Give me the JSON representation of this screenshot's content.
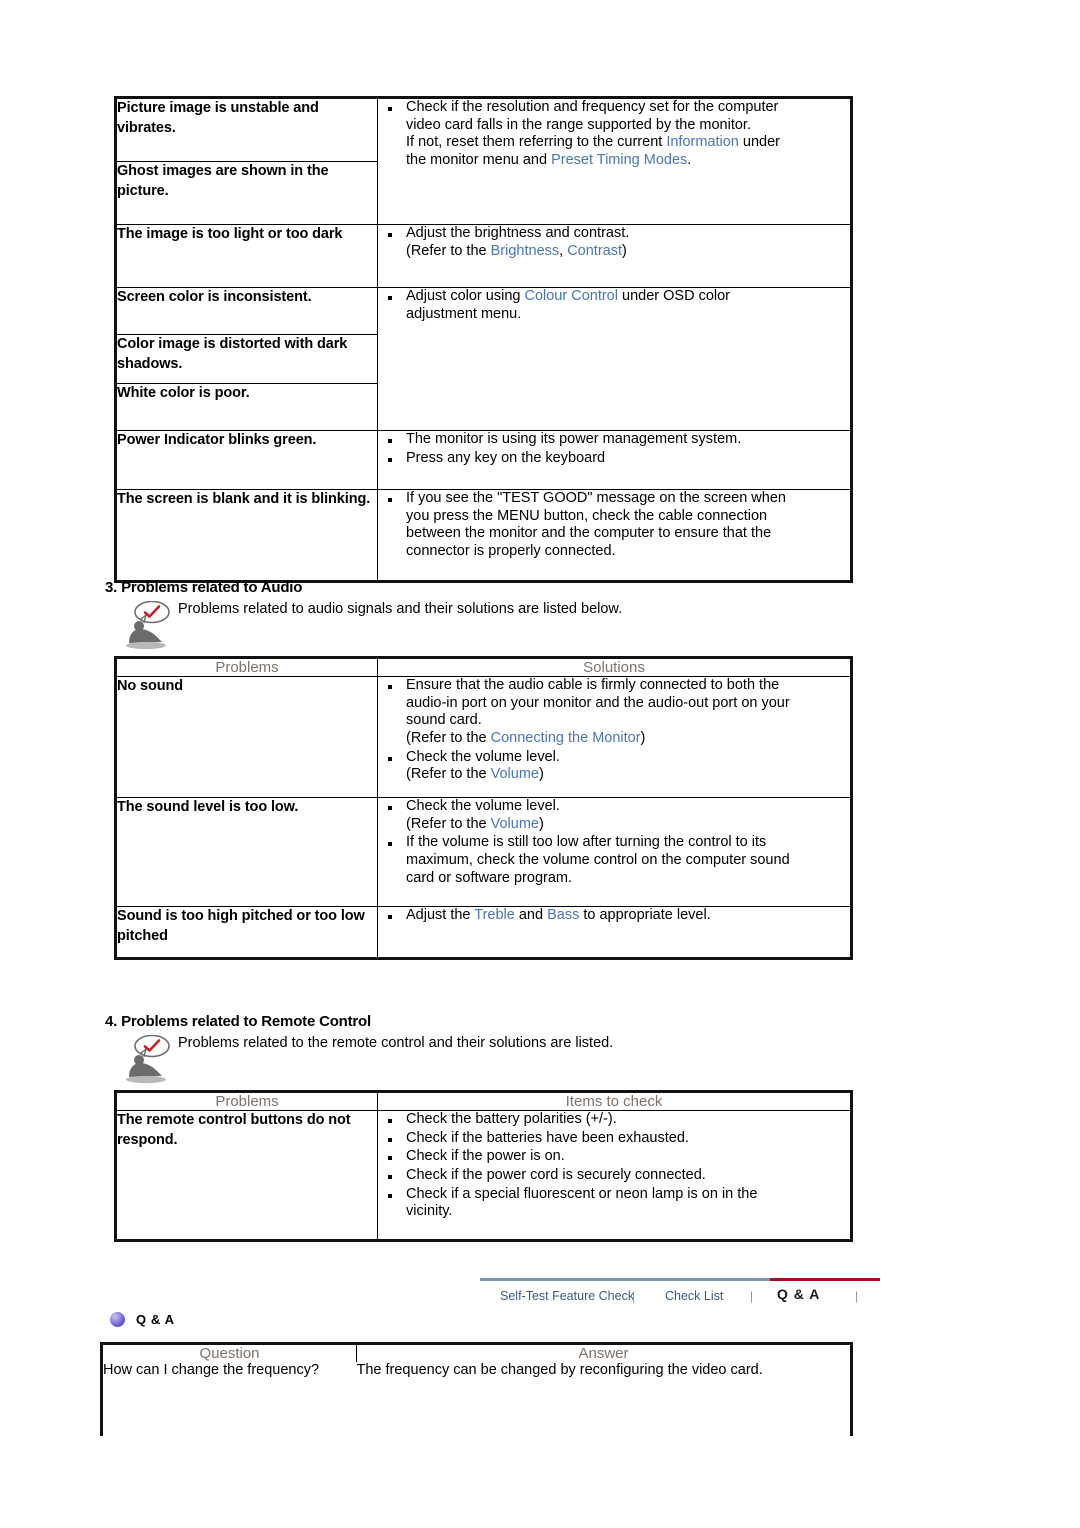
{
  "display_table": {
    "rows": [
      {
        "problem": "Picture image is unstable and vibrates.",
        "solution_bullets": [
          {
            "lines": [
              [
                {
                  "t": "Check if the resolution and frequency set for the computer"
                }
              ],
              [
                {
                  "t": "video card falls in the range supported by the monitor."
                }
              ],
              [
                {
                  "t": "If not, reset them referring to the current "
                },
                {
                  "t": "Information",
                  "link": true
                },
                {
                  "t": " under"
                }
              ],
              [
                {
                  "t": "the monitor menu and "
                },
                {
                  "t": "Preset Timing Modes",
                  "link": true
                },
                {
                  "t": "."
                }
              ]
            ]
          }
        ]
      },
      {
        "problem": "Ghost images are shown in the picture.",
        "solution_bullets": []
      },
      {
        "problem": "The image is too light or too dark",
        "solution_bullets": [
          {
            "lines": [
              [
                {
                  "t": "Adjust the brightness and contrast."
                }
              ],
              [
                {
                  "t": "(Refer to the "
                },
                {
                  "t": "Brightness",
                  "link": true
                },
                {
                  "t": ", "
                },
                {
                  "t": "Contrast",
                  "link": true
                },
                {
                  "t": ")"
                }
              ]
            ]
          }
        ]
      },
      {
        "problem": "Screen color is inconsistent.",
        "solution_bullets": [
          {
            "lines": [
              [
                {
                  "t": "Adjust color using "
                },
                {
                  "t": "Colour Control",
                  "link": true
                },
                {
                  "t": " under OSD color"
                }
              ],
              [
                {
                  "t": "adjustment menu."
                }
              ]
            ]
          }
        ]
      },
      {
        "problem": "Color image is distorted with dark shadows.",
        "solution_bullets": []
      },
      {
        "problem": "White color is poor.",
        "solution_bullets": []
      },
      {
        "problem": "Power Indicator blinks green.",
        "solution_bullets": [
          {
            "lines": [
              [
                {
                  "t": "The monitor is using its power management system."
                }
              ]
            ]
          },
          {
            "lines": [
              [
                {
                  "t": "Press any key on the keyboard"
                }
              ]
            ]
          }
        ]
      },
      {
        "problem": "The screen is blank and it is blinking.",
        "solution_bullets": [
          {
            "lines": [
              [
                {
                  "t": "If you see the \"TEST GOOD\" message on the screen when"
                }
              ],
              [
                {
                  "t": "you press the MENU button, check the cable connection"
                }
              ],
              [
                {
                  "t": "between the monitor and the computer to ensure that the"
                }
              ],
              [
                {
                  "t": "connector is properly connected."
                }
              ]
            ]
          }
        ]
      }
    ]
  },
  "audio_section": {
    "heading": "3. Problems related to Audio",
    "note": "Problems related to audio signals and their solutions are listed below.",
    "icon": "person-with-checkmark-speech-bubble-icon",
    "columns": [
      "Problems",
      "Solutions"
    ],
    "rows": [
      {
        "problem": "No sound",
        "solution_bullets": [
          {
            "lines": [
              [
                {
                  "t": "Ensure that the audio cable is firmly connected to both the"
                }
              ],
              [
                {
                  "t": "audio-in port on your monitor and the audio-out port on your"
                }
              ],
              [
                {
                  "t": "sound card."
                }
              ],
              [
                {
                  "t": "(Refer to the "
                },
                {
                  "t": "Connecting the Monitor",
                  "link": true
                },
                {
                  "t": ")"
                }
              ]
            ]
          },
          {
            "lines": [
              [
                {
                  "t": "Check the volume level."
                }
              ],
              [
                {
                  "t": "(Refer to the "
                },
                {
                  "t": "Volume",
                  "link": true
                },
                {
                  "t": ")"
                }
              ]
            ]
          }
        ]
      },
      {
        "problem": "The sound level is too low.",
        "solution_bullets": [
          {
            "lines": [
              [
                {
                  "t": "Check the volume level."
                }
              ],
              [
                {
                  "t": "(Refer to the "
                },
                {
                  "t": "Volume",
                  "link": true
                },
                {
                  "t": ")"
                }
              ]
            ]
          },
          {
            "lines": [
              [
                {
                  "t": "If the volume is still too low after turning the control to its"
                }
              ],
              [
                {
                  "t": "maximum, check the volume control on the computer sound"
                }
              ],
              [
                {
                  "t": "card or software program."
                }
              ]
            ]
          }
        ]
      },
      {
        "problem": "Sound is too high pitched or too low pitched",
        "solution_bullets": [
          {
            "lines": [
              [
                {
                  "t": "Adjust the "
                },
                {
                  "t": "Treble",
                  "link": true
                },
                {
                  "t": " and "
                },
                {
                  "t": "Bass",
                  "link": true
                },
                {
                  "t": " to appropriate level."
                }
              ]
            ]
          }
        ]
      }
    ]
  },
  "remote_section": {
    "heading": "4. Problems related to Remote Control",
    "note": "Problems related to the remote control and their solutions are listed.",
    "icon": "person-with-checkmark-speech-bubble-icon",
    "columns": [
      "Problems",
      "Items to check"
    ],
    "rows": [
      {
        "problem": "The remote control buttons do not respond.",
        "solution_bullets": [
          {
            "lines": [
              [
                {
                  "t": "Check the battery polarities (+/-)."
                }
              ]
            ]
          },
          {
            "lines": [
              [
                {
                  "t": "Check if the batteries have been exhausted."
                }
              ]
            ]
          },
          {
            "lines": [
              [
                {
                  "t": "Check if the power is on."
                }
              ]
            ]
          },
          {
            "lines": [
              [
                {
                  "t": "Check if the power cord is securely connected."
                }
              ]
            ]
          },
          {
            "lines": [
              [
                {
                  "t": "Check if a special fluorescent or neon lamp is on in the"
                }
              ],
              [
                {
                  "t": "vicinity."
                }
              ]
            ]
          }
        ]
      }
    ]
  },
  "nav": {
    "items": [
      {
        "label": "Self-Test Feature Check",
        "active": false
      },
      {
        "label": "Check List",
        "active": false
      },
      {
        "label": "Q & A",
        "active": true
      }
    ],
    "separator": "|",
    "inactive_rule_color": "#7f93ad",
    "active_rule_color": "#aa0f28"
  },
  "qa_section": {
    "heading": "Q & A",
    "bullet_icon": "purple-sphere-bullet-icon",
    "columns": [
      "Question",
      "Answer"
    ],
    "rows": [
      {
        "question": "How can I change the frequency?",
        "answer": "The frequency can be changed by reconfiguring the video card."
      }
    ]
  },
  "colors": {
    "link": "#4a76b8",
    "column_header_text": "#7d736b",
    "table_border": "#000000",
    "nav_inactive_text": "#3c5a86",
    "nav_active_rule": "#aa0f28"
  }
}
